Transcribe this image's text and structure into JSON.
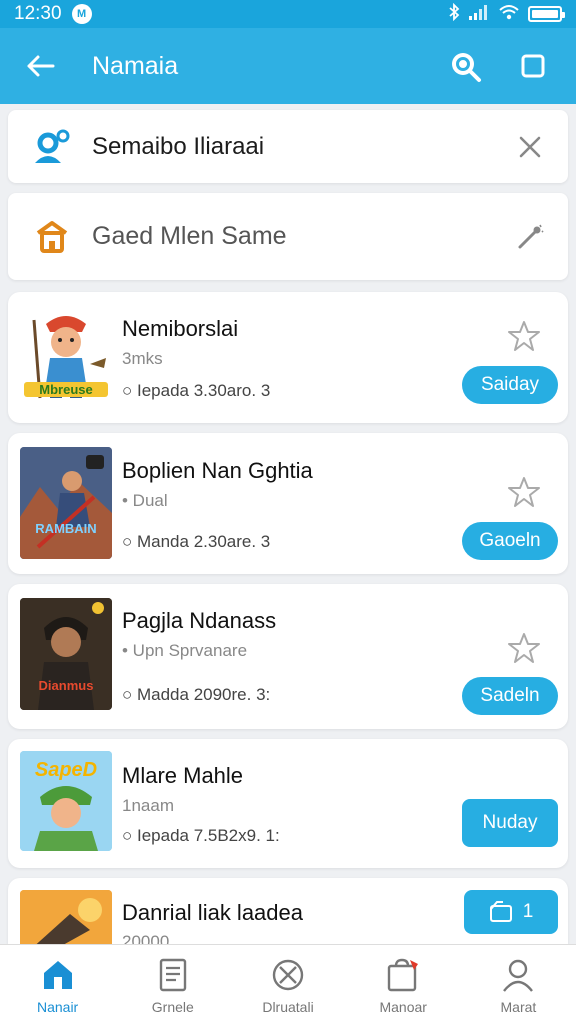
{
  "status_bar": {
    "time": "12:30",
    "badge": "M"
  },
  "app_bar": {
    "title": "Namaia"
  },
  "filters": [
    {
      "label": "Semaibo Iliaraai",
      "icon": "user-gear-icon",
      "action_icon": "close-icon"
    },
    {
      "label": "Gaed Mlen Same",
      "icon": "home-icon",
      "action_icon": "wand-icon"
    }
  ],
  "list": [
    {
      "title": "Nemiborslai",
      "subtitle": "3mks",
      "meta": "○ Iepada 3.30aro. 3",
      "button": "Saiday",
      "thumb_label": "Mbreuse"
    },
    {
      "title": "Boplien Nan Gghtia",
      "subtitle": "• Dual",
      "meta": "○ Manda 2.30are. 3",
      "button": "Gaoeln",
      "thumb_label": "RAMBAIN"
    },
    {
      "title": "Pagjla Ndanass",
      "subtitle": "• Upn Sprvanare",
      "meta": "○ Madda 2090re. 3:",
      "button": "Sadeln",
      "thumb_label": "Dianmus"
    },
    {
      "title": "Mlare Mahle",
      "subtitle": "1naam",
      "meta": "○ Iepada 7.5B2x9. 1:",
      "button": "Nuday",
      "thumb_label": "SapeD"
    },
    {
      "title": "Danrial liak laadea",
      "subtitle": "20000",
      "meta": "",
      "button": "1",
      "thumb_label": ""
    }
  ],
  "bottom_nav": [
    {
      "label": "Nanair",
      "icon": "home-icon",
      "active": true
    },
    {
      "label": "Grnele",
      "icon": "document-icon",
      "active": false
    },
    {
      "label": "Dlruatali",
      "icon": "compass-icon",
      "active": false
    },
    {
      "label": "Manoar",
      "icon": "bag-icon",
      "active": false
    },
    {
      "label": "Marat",
      "icon": "person-icon",
      "active": false
    }
  ],
  "colors": {
    "accent": "#2fb0e3",
    "status_bar": "#1aa5dc",
    "button": "#27aee2",
    "active_nav": "#1a8fd4"
  }
}
